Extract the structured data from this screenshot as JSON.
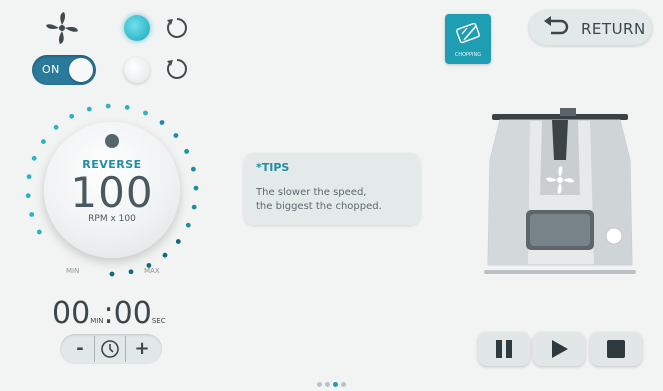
{
  "toggle": {
    "label": "ON"
  },
  "dial": {
    "mode": "REVERSE",
    "speed": "100",
    "unit": "RPM x 100",
    "min_label": "MIN",
    "max_label": "MAX"
  },
  "timer": {
    "minutes": "00",
    "minutes_unit": "MIN",
    "seconds": "00",
    "seconds_unit": "SEC",
    "separator": ":"
  },
  "timer_controls": {
    "minus": "-",
    "plus": "+"
  },
  "tips": {
    "title": "*TIPS",
    "line1": "The slower the speed,",
    "line2": "the biggest the chopped."
  },
  "mode_button": {
    "label": "CHOPPING"
  },
  "return_button": {
    "label": "RETURN"
  },
  "pager": {
    "count": 4,
    "active": 3
  },
  "colors": {
    "accent": "#1f9db3",
    "toggle": "#2a7a9b"
  }
}
